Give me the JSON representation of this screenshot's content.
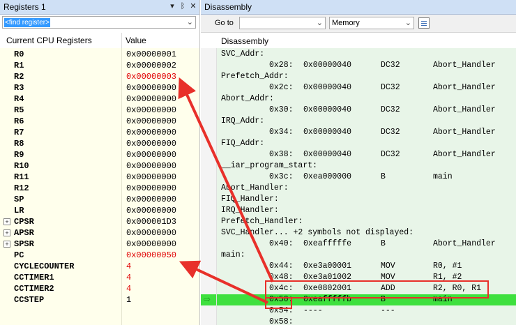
{
  "registers": {
    "title": "Registers 1",
    "find_value": "<find register>",
    "col_name": "Current CPU Registers",
    "col_value": "Value",
    "rows": [
      {
        "name": "R0",
        "value": "0x00000001",
        "changed": false,
        "expandable": false
      },
      {
        "name": "R1",
        "value": "0x00000002",
        "changed": false,
        "expandable": false
      },
      {
        "name": "R2",
        "value": "0x00000003",
        "changed": true,
        "expandable": false
      },
      {
        "name": "R3",
        "value": "0x00000000",
        "changed": false,
        "expandable": false
      },
      {
        "name": "R4",
        "value": "0x00000000",
        "changed": false,
        "expandable": false
      },
      {
        "name": "R5",
        "value": "0x00000000",
        "changed": false,
        "expandable": false
      },
      {
        "name": "R6",
        "value": "0x00000000",
        "changed": false,
        "expandable": false
      },
      {
        "name": "R7",
        "value": "0x00000000",
        "changed": false,
        "expandable": false
      },
      {
        "name": "R8",
        "value": "0x00000000",
        "changed": false,
        "expandable": false
      },
      {
        "name": "R9",
        "value": "0x00000000",
        "changed": false,
        "expandable": false
      },
      {
        "name": "R10",
        "value": "0x00000000",
        "changed": false,
        "expandable": false
      },
      {
        "name": "R11",
        "value": "0x00000000",
        "changed": false,
        "expandable": false
      },
      {
        "name": "R12",
        "value": "0x00000000",
        "changed": false,
        "expandable": false
      },
      {
        "name": "SP",
        "value": "0x00000000",
        "changed": false,
        "expandable": false
      },
      {
        "name": "LR",
        "value": "0x00000000",
        "changed": false,
        "expandable": false
      },
      {
        "name": "CPSR",
        "value": "0x000001D3",
        "changed": false,
        "expandable": true
      },
      {
        "name": "APSR",
        "value": "0x00000000",
        "changed": false,
        "expandable": true
      },
      {
        "name": "SPSR",
        "value": "0x00000000",
        "changed": false,
        "expandable": true
      },
      {
        "name": "PC",
        "value": "0x00000050",
        "changed": true,
        "expandable": false
      },
      {
        "name": "CYCLECOUNTER",
        "value": "4",
        "changed": true,
        "expandable": false
      },
      {
        "name": "CCTIMER1",
        "value": "4",
        "changed": true,
        "expandable": false
      },
      {
        "name": "CCTIMER2",
        "value": "4",
        "changed": true,
        "expandable": false
      },
      {
        "name": "CCSTEP",
        "value": "1",
        "changed": false,
        "expandable": false
      }
    ]
  },
  "disassembly": {
    "title": "Disassembly",
    "goto_label": "Go to",
    "goto_value": "",
    "memory_option": "Memory",
    "header": "Disassembly",
    "lines": [
      {
        "label": "SVC_Addr:"
      },
      {
        "addr": "0x28:",
        "op": "0x00000040",
        "mn": "DC32",
        "args": "Abort_Handler"
      },
      {
        "label": "Prefetch_Addr:"
      },
      {
        "addr": "0x2c:",
        "op": "0x00000040",
        "mn": "DC32",
        "args": "Abort_Handler"
      },
      {
        "label": "Abort_Addr:"
      },
      {
        "addr": "0x30:",
        "op": "0x00000040",
        "mn": "DC32",
        "args": "Abort_Handler"
      },
      {
        "label": "IRQ_Addr:"
      },
      {
        "addr": "0x34:",
        "op": "0x00000040",
        "mn": "DC32",
        "args": "Abort_Handler"
      },
      {
        "label": "FIQ_Addr:"
      },
      {
        "addr": "0x38:",
        "op": "0x00000040",
        "mn": "DC32",
        "args": "Abort_Handler"
      },
      {
        "label": "__iar_program_start:"
      },
      {
        "addr": "0x3c:",
        "op": "0xea000000",
        "mn": "B",
        "args": "main"
      },
      {
        "label": "Abort_Handler:"
      },
      {
        "label": "FIQ_Handler:"
      },
      {
        "label": "IRQ_Handler:"
      },
      {
        "label": "Prefetch_Handler:"
      },
      {
        "label": "SVC_Handler... +2 symbols not displayed:"
      },
      {
        "addr": "0x40:",
        "op": "0xeafffffe",
        "mn": "B",
        "args": "Abort_Handler"
      },
      {
        "label": "main:"
      },
      {
        "addr": "0x44:",
        "op": "0xe3a00001",
        "mn": "MOV",
        "args": "R0, #1"
      },
      {
        "addr": "0x48:",
        "op": "0xe3a01002",
        "mn": "MOV",
        "args": "R1, #2"
      },
      {
        "addr": "0x4c:",
        "op": "0xe0802001",
        "mn": "ADD",
        "args": "R2, R0, R1"
      },
      {
        "addr": "0x50:",
        "op": "0xeafffffb",
        "mn": "B",
        "args": "main",
        "current": true
      },
      {
        "addr": "0x54:",
        "op": "----",
        "mn": "---",
        "args": ""
      },
      {
        "addr": "0x58:",
        "op": "",
        "mn": "",
        "args": ""
      }
    ]
  },
  "colors": {
    "changed_value": "#e00000",
    "current_line": "#3ee03e",
    "annotation": "#e8302a",
    "titlebar": "#cfe0f5"
  }
}
